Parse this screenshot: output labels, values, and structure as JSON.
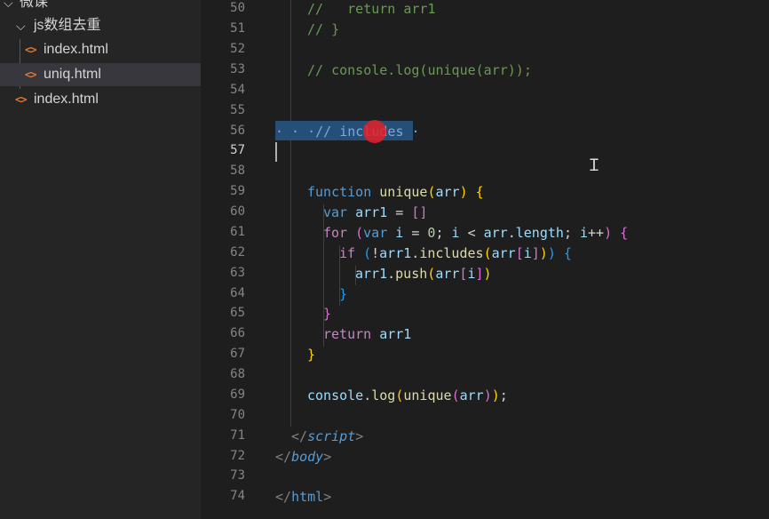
{
  "sidebar": {
    "top_folder": "微课",
    "folder": "js数组去重",
    "folder_files": [
      "index.html",
      "uniq.html"
    ],
    "root_file": "index.html",
    "file_icon_glyph": "<>"
  },
  "editor": {
    "line_numbers": [
      "50",
      "51",
      "52",
      "53",
      "54",
      "55",
      "56",
      "57",
      "58",
      "59",
      "60",
      "61",
      "62",
      "63",
      "64",
      "65",
      "66",
      "67",
      "68",
      "69",
      "70",
      "71",
      "72",
      "73",
      "74"
    ],
    "active_line": "57",
    "code": {
      "l50_comment": "//   return arr1",
      "l51_comment": "// }",
      "l53_comment": "// console.log(unique(arr));",
      "l56_selected": "· · ·// includes ·",
      "l59": [
        "function",
        "unique",
        "(",
        "arr",
        ")",
        "{"
      ],
      "l60": [
        "var",
        "arr1",
        "=",
        "[]"
      ],
      "l61": [
        "for",
        "(",
        "var",
        "i",
        "=",
        "0",
        ";",
        "i",
        "<",
        "arr",
        ".",
        "length",
        ";",
        "i",
        "++",
        ")",
        "{"
      ],
      "l62": [
        "if",
        "(",
        "!",
        "arr1",
        ".",
        "includes",
        "(",
        "arr",
        "[",
        "i",
        "]",
        ")",
        ")",
        "{"
      ],
      "l63": [
        "arr1",
        ".",
        "push",
        "(",
        "arr",
        "[",
        "i",
        "]",
        ")"
      ],
      "l64": "}",
      "l65": "}",
      "l66": [
        "return",
        "arr1"
      ],
      "l67": "}",
      "l69": [
        "console",
        ".",
        "log",
        "(",
        "unique",
        "(",
        "arr",
        ")",
        ")",
        ";"
      ],
      "l71": [
        "</",
        "script",
        ">"
      ],
      "l72": [
        "</",
        "body",
        ">"
      ],
      "l74": [
        "</",
        "html",
        ">"
      ]
    }
  }
}
